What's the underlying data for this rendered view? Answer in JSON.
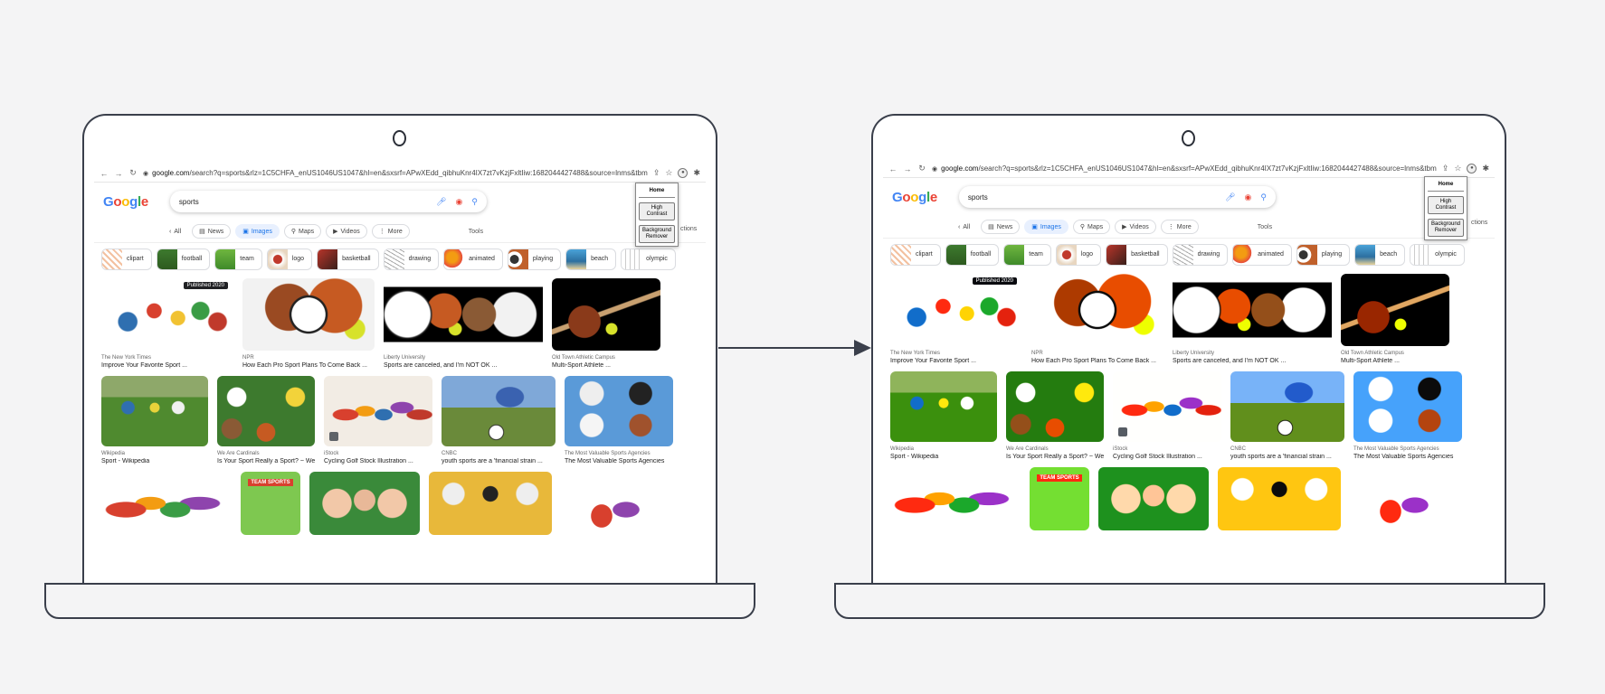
{
  "browser": {
    "url_domain": "google.com",
    "url_rest": "/search?q=sports&rlz=1C5CHFA_enUS1046US1047&hl=en&sxsrf=APwXEdd_qibhuKnr4IX7zt7vKzjFxltIiw:1682044427488&source=lnms&tbm=isc..."
  },
  "google": {
    "query": "sports",
    "tabs": [
      {
        "label": "All"
      },
      {
        "label": "News"
      },
      {
        "label": "Images"
      },
      {
        "label": "Maps"
      },
      {
        "label": "Videos"
      },
      {
        "label": "More"
      }
    ],
    "tools_label": "Tools",
    "chips": [
      "clipart",
      "football",
      "team",
      "logo",
      "basketball",
      "drawing",
      "animated",
      "playing",
      "beach",
      "olympic"
    ],
    "row1": [
      {
        "source": "The New York Times",
        "title": "Improve Your Favorite Sport ...",
        "badge": "Published 2020"
      },
      {
        "source": "NPR",
        "title": "How Each Pro Sport Plans To Come Back ..."
      },
      {
        "source": "Liberty University",
        "title": "Sports are canceled, and I'm NOT OK ..."
      },
      {
        "source": "Old Town Athletic Campus",
        "title": "Multi-Sport Athlete ..."
      }
    ],
    "row2": [
      {
        "source": "Wikipedia",
        "title": "Sport - Wikipedia"
      },
      {
        "source": "We Are Cardinals",
        "title": "Is Your Sport Really a Sport? ~ We ..."
      },
      {
        "source": "iStock",
        "title": "Cycling Golf Stock Illustration ..."
      },
      {
        "source": "CNBC",
        "title": "youth sports are a 'financial strain ..."
      },
      {
        "source": "The Most Valuable Sports Agencies",
        "title": "The Most Valuable Sports Agencies"
      }
    ],
    "row3_label": "TEAM SPORTS"
  },
  "popup": {
    "home": "Home",
    "high_contrast": "High Contrast",
    "background_remover": "Background Remover"
  },
  "header_right_text": "ctions"
}
